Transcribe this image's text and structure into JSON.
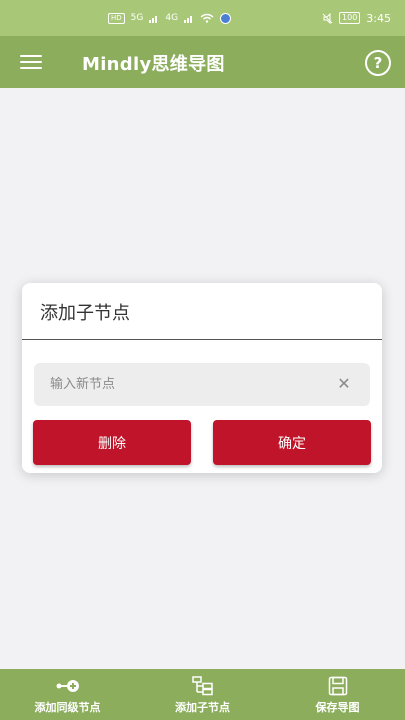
{
  "status_bar": {
    "carrier_badges": [
      "HD",
      "5G",
      "4G"
    ],
    "battery": "100",
    "time": "3:45"
  },
  "app_bar": {
    "title": "Mindly思维导图",
    "help_glyph": "?"
  },
  "dialog": {
    "title": "添加子节点",
    "input_value": "",
    "input_placeholder": "输入新节点",
    "clear_glyph": "✕",
    "delete_label": "删除",
    "confirm_label": "确定"
  },
  "bottom_nav": {
    "items": [
      {
        "label": "添加同级节点",
        "icon": "add-sibling-node-icon"
      },
      {
        "label": "添加子节点",
        "icon": "add-child-node-icon"
      },
      {
        "label": "保存导图",
        "icon": "save-icon"
      }
    ]
  },
  "colors": {
    "status_bar": "#a8c878",
    "app_bar": "#8cad5c",
    "button": "#c0142a",
    "background": "#f2f2f4"
  }
}
